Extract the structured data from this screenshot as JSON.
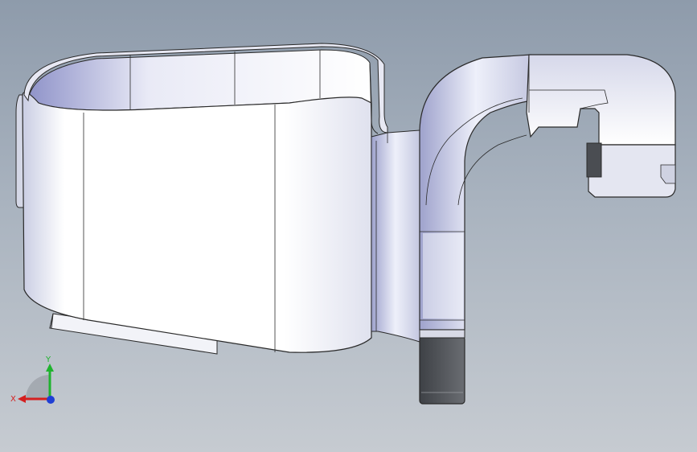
{
  "viewport": {
    "background_top": "#8e9bab",
    "background_bottom": "#c6cbd1",
    "model": "bracket-clip-part"
  },
  "triad": {
    "x_label": "X",
    "y_label": "Y",
    "x_color": "#d41f1f",
    "y_color": "#1fb32e",
    "z_color": "#1f3fd4"
  }
}
